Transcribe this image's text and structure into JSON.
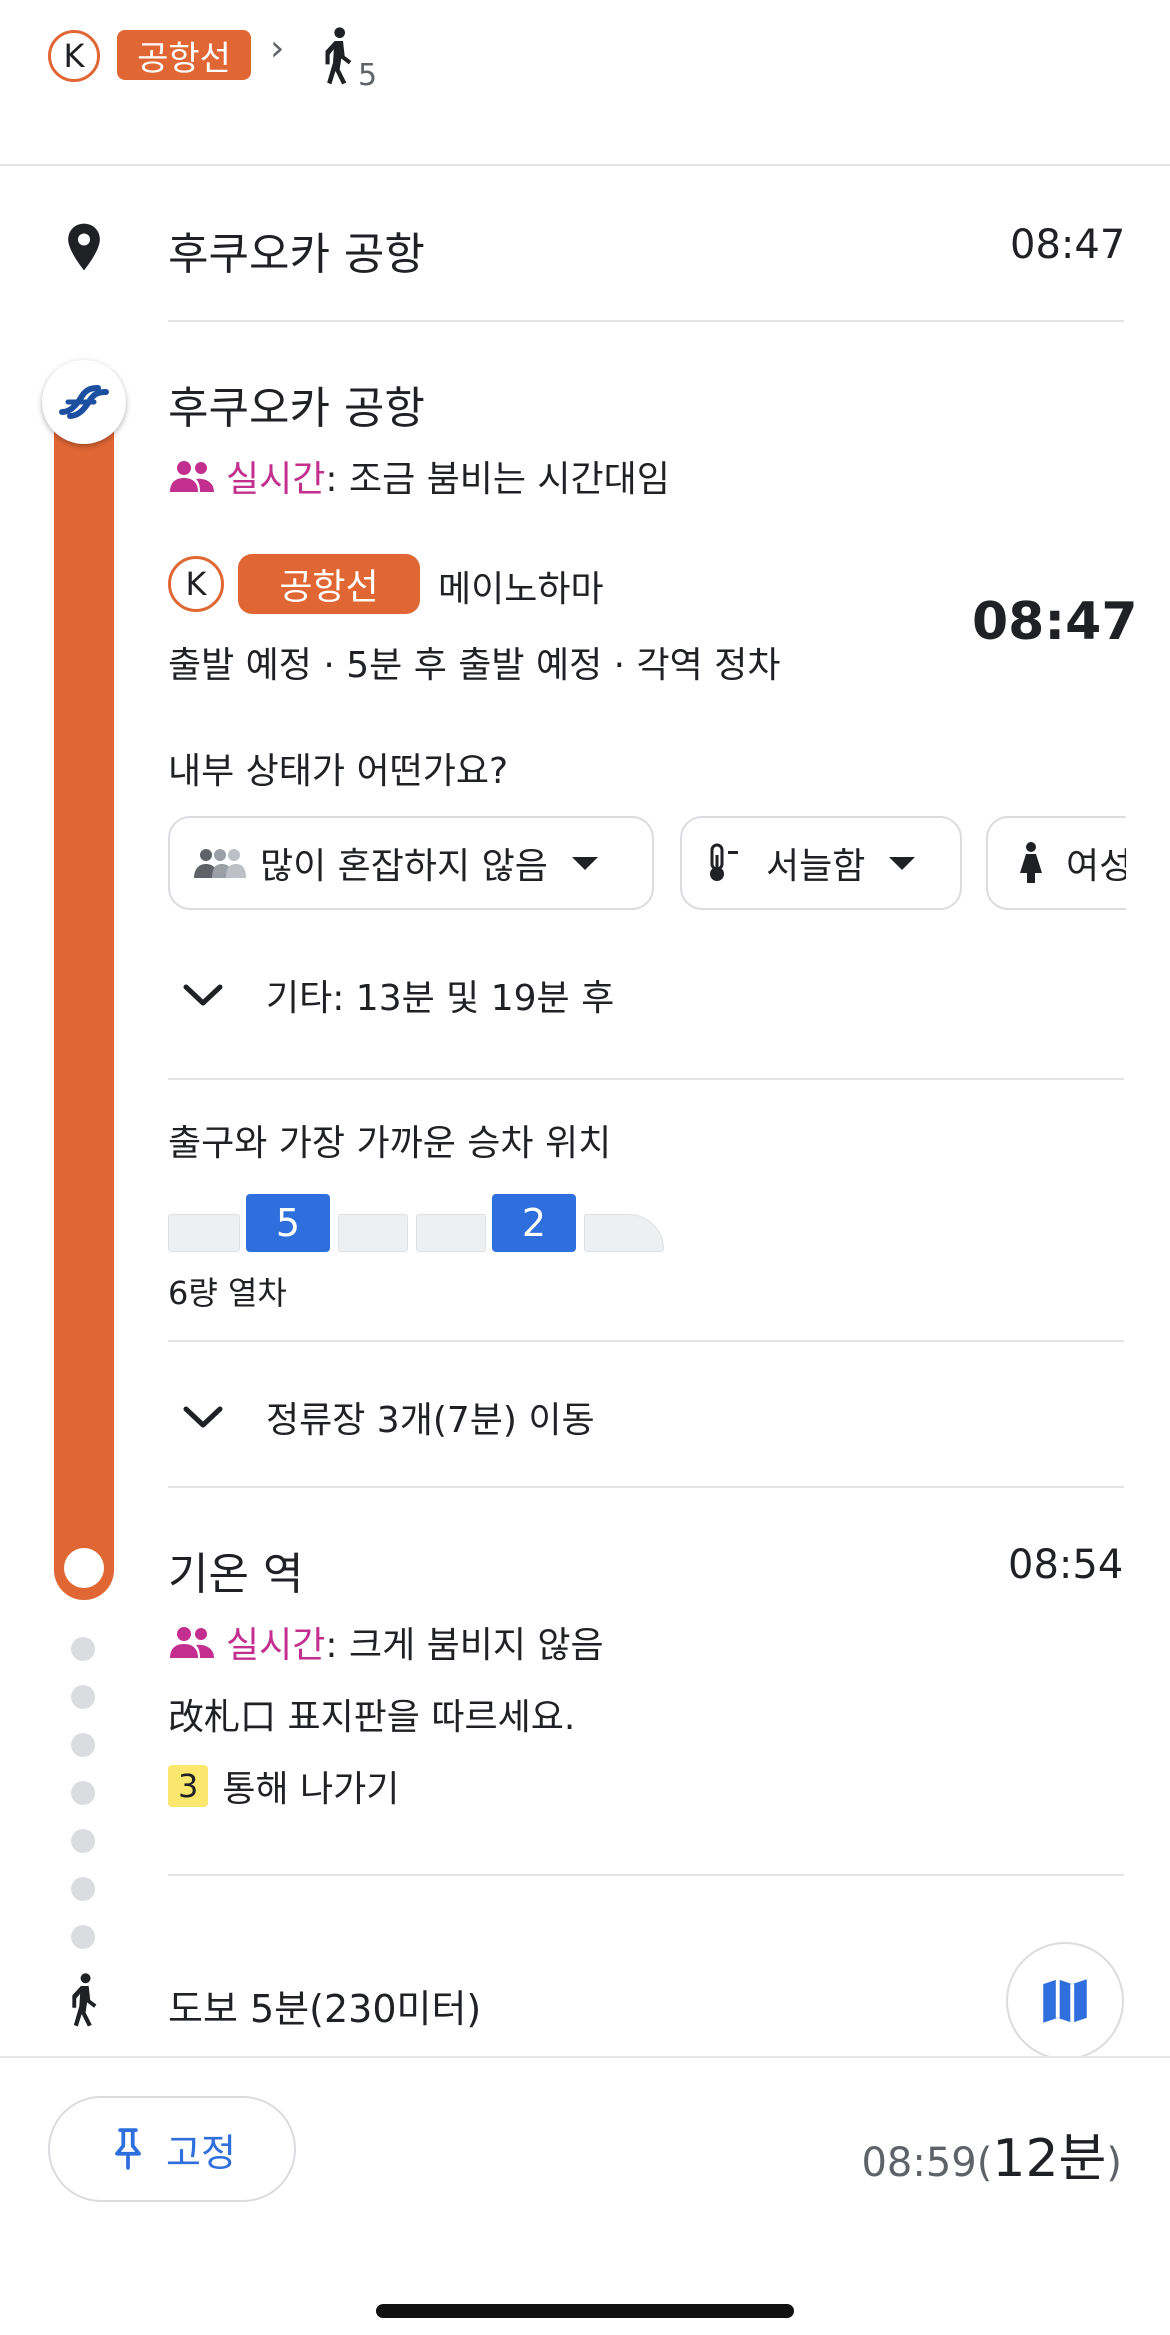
{
  "header": {
    "k_label": "K",
    "line_label": "공항선",
    "arrow": "›",
    "walk_minutes": "5"
  },
  "origin": {
    "name": "후쿠오카 공항",
    "time": "08:47"
  },
  "departure": {
    "station": "후쿠오카 공항",
    "crowd_label": "실시간",
    "crowd_text": ": 조금 붐비는 시간대임",
    "k_label": "K",
    "line_label": "공항선",
    "direction": "메이노하마",
    "time": "08:47",
    "status": "출발 예정 · 5분 후 출발 예정 · 각역 정차",
    "question": "내부 상태가 어떤가요?",
    "chips": [
      {
        "label": "많이 혼잡하지 않음"
      },
      {
        "label": "서늘함"
      },
      {
        "label": "여성"
      }
    ],
    "other": "기타: 13분 및 19분 후",
    "boarding_title": "출구와 가장 가까운 승차 위치",
    "cars": [
      "",
      "5",
      "",
      "",
      "2",
      ""
    ],
    "train_length": "6량 열차",
    "stops": "정류장 3개(7분) 이동"
  },
  "arrival": {
    "station": "기온 역",
    "time": "08:54",
    "crowd_label": "실시간",
    "crowd_text": ": 크게 붐비지 않음",
    "instruction": "改札口 표지판을 따르세요.",
    "exit_number": "3",
    "exit_text": "통해 나가기"
  },
  "walk": {
    "text": "도보 5분(230미터)"
  },
  "footer": {
    "pin_label": "고정",
    "arrival_time": "08:59(",
    "duration": "12분",
    "close_paren": ")"
  },
  "colors": {
    "line": "#e06633",
    "realtime": "#c22f8e",
    "accent_blue": "#2f6fdd",
    "exit_yellow": "#fbe66e"
  }
}
